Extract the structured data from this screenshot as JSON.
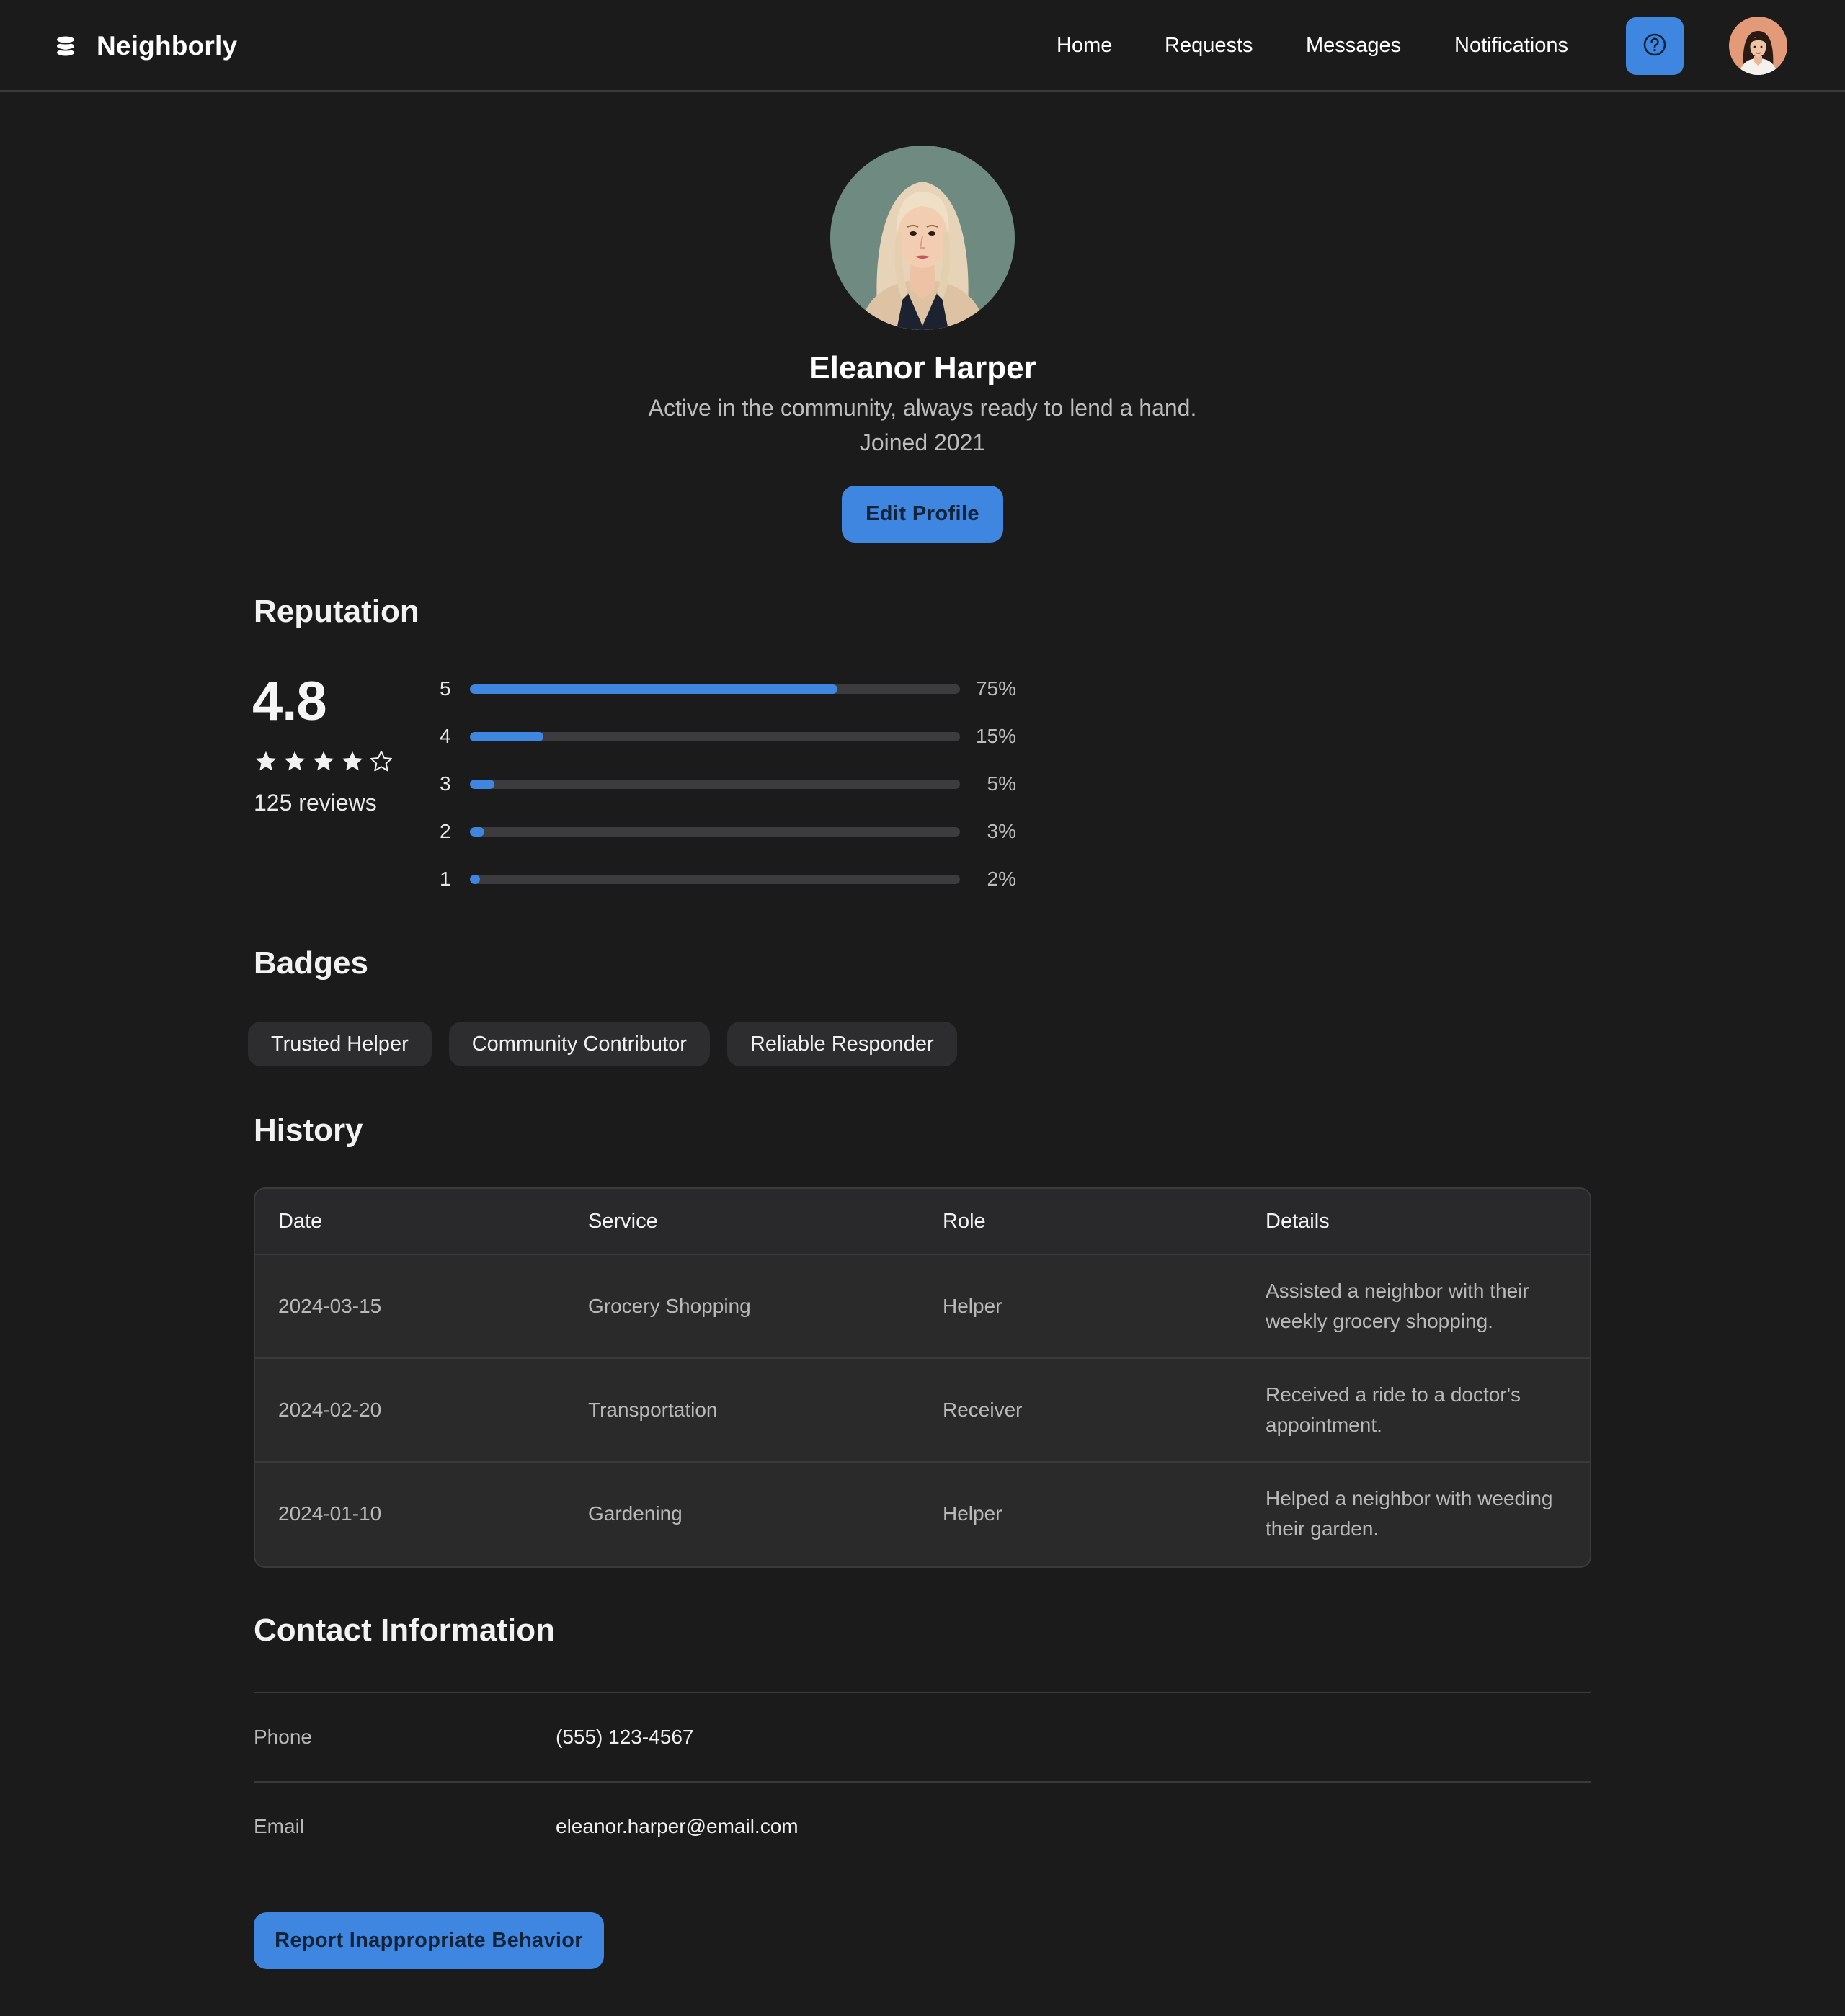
{
  "app": {
    "name": "Neighborly",
    "logo_icon": "stack-logo-icon",
    "accent_color": "#3f86e0",
    "background_color": "#1b1b1c"
  },
  "nav": {
    "links": [
      {
        "label": "Home"
      },
      {
        "label": "Requests"
      },
      {
        "label": "Messages"
      },
      {
        "label": "Notifications"
      }
    ],
    "help_icon": "question-circle-icon",
    "avatar_icon": "user-avatar"
  },
  "profile": {
    "name": "Eleanor Harper",
    "tagline": "Active in the community, always ready to lend a hand.",
    "joined": "Joined 2021",
    "edit_label": "Edit Profile"
  },
  "reputation": {
    "title": "Reputation",
    "rating": "4.8",
    "stars_filled": 4,
    "stars_total": 5,
    "reviews": "125 reviews",
    "distribution": [
      {
        "star": "5",
        "percent_label": "75%",
        "fraction": 0.75
      },
      {
        "star": "4",
        "percent_label": "15%",
        "fraction": 0.15
      },
      {
        "star": "3",
        "percent_label": "5%",
        "fraction": 0.05
      },
      {
        "star": "2",
        "percent_label": "3%",
        "fraction": 0.03
      },
      {
        "star": "1",
        "percent_label": "2%",
        "fraction": 0.02
      }
    ]
  },
  "badges": {
    "title": "Badges",
    "items": [
      "Trusted Helper",
      "Community Contributor",
      "Reliable Responder"
    ]
  },
  "history": {
    "title": "History",
    "columns": [
      "Date",
      "Service",
      "Role",
      "Details"
    ],
    "rows": [
      {
        "date": "2024-03-15",
        "service": "Grocery Shopping",
        "role": "Helper",
        "details": "Assisted a neighbor with their weekly grocery shopping."
      },
      {
        "date": "2024-02-20",
        "service": "Transportation",
        "role": "Receiver",
        "details": "Received a ride to a doctor's appointment."
      },
      {
        "date": "2024-01-10",
        "service": "Gardening",
        "role": "Helper",
        "details": "Helped a neighbor with weeding their garden."
      }
    ]
  },
  "contact": {
    "title": "Contact Information",
    "phone_label": "Phone",
    "phone": "(555) 123-4567",
    "email_label": "Email",
    "email": "eleanor.harper@email.com"
  },
  "report": {
    "label": "Report Inappropriate Behavior"
  }
}
